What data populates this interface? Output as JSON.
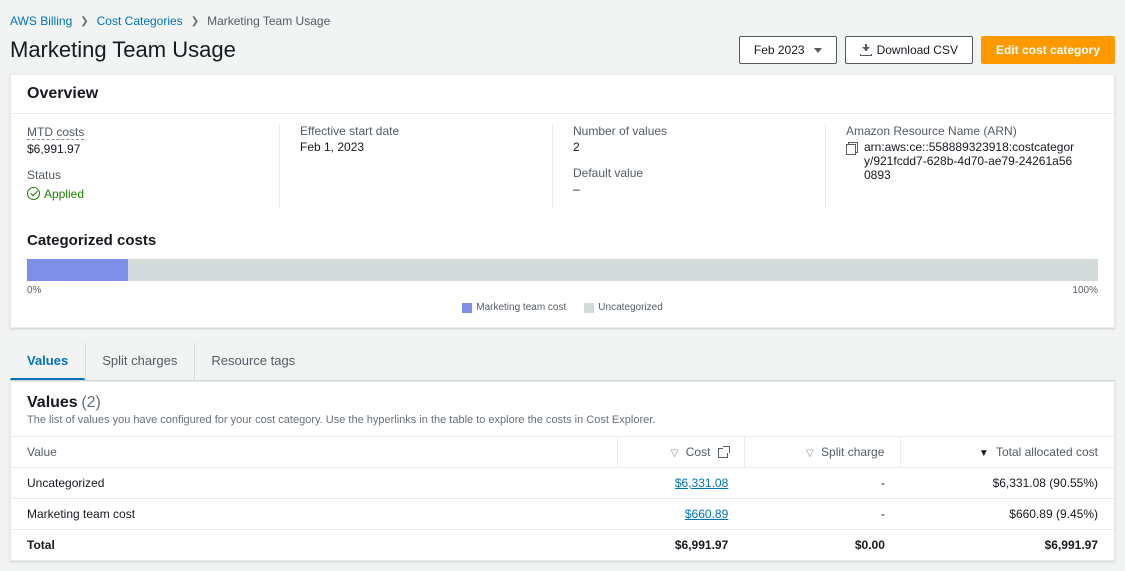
{
  "breadcrumbs": {
    "l0": "AWS Billing",
    "l1": "Cost Categories",
    "l2": "Marketing Team Usage"
  },
  "page_title": "Marketing Team Usage",
  "actions": {
    "period": "Feb 2023",
    "download": "Download CSV",
    "edit": "Edit cost category"
  },
  "overview": {
    "title": "Overview",
    "mtd_label": "MTD costs",
    "mtd_value": "$6,991.97",
    "status_label": "Status",
    "status_value": "Applied",
    "effective_label": "Effective start date",
    "effective_value": "Feb 1, 2023",
    "numvalues_label": "Number of values",
    "numvalues_value": "2",
    "default_label": "Default value",
    "default_value": "–",
    "arn_label": "Amazon Resource Name (ARN)",
    "arn_value": "arn:aws:ce::558889323918:costcategory/921fcdd7-628b-4d70-ae79-24261a560893"
  },
  "categorized": {
    "title": "Categorized costs",
    "left": "0%",
    "right": "100%",
    "legend1": "Marketing team cost",
    "legend2": "Uncategorized"
  },
  "tabs": {
    "t0": "Values",
    "t1": "Split charges",
    "t2": "Resource tags"
  },
  "values": {
    "title": "Values",
    "count": "(2)",
    "desc": "The list of values you have configured for your cost category. Use the hyperlinks in the table to explore the costs in Cost Explorer.",
    "col_value": "Value",
    "col_cost": "Cost",
    "col_split": "Split charge",
    "col_total": "Total allocated cost",
    "rows": [
      {
        "name": "Uncategorized",
        "cost": "$6,331.08",
        "split": "-",
        "total": "$6,331.08 (90.55%)"
      },
      {
        "name": "Marketing team cost",
        "cost": "$660.89",
        "split": "-",
        "total": "$660.89 (9.45%)"
      }
    ],
    "total_label": "Total",
    "total_cost": "$6,991.97",
    "total_split": "$0.00",
    "total_total": "$6,991.97"
  },
  "chart_data": {
    "type": "bar",
    "orientation": "horizontal-stacked",
    "categories": [
      "Marketing team cost",
      "Uncategorized"
    ],
    "values": [
      9.45,
      90.55
    ],
    "unit": "percent",
    "xlim": [
      0,
      100
    ]
  }
}
